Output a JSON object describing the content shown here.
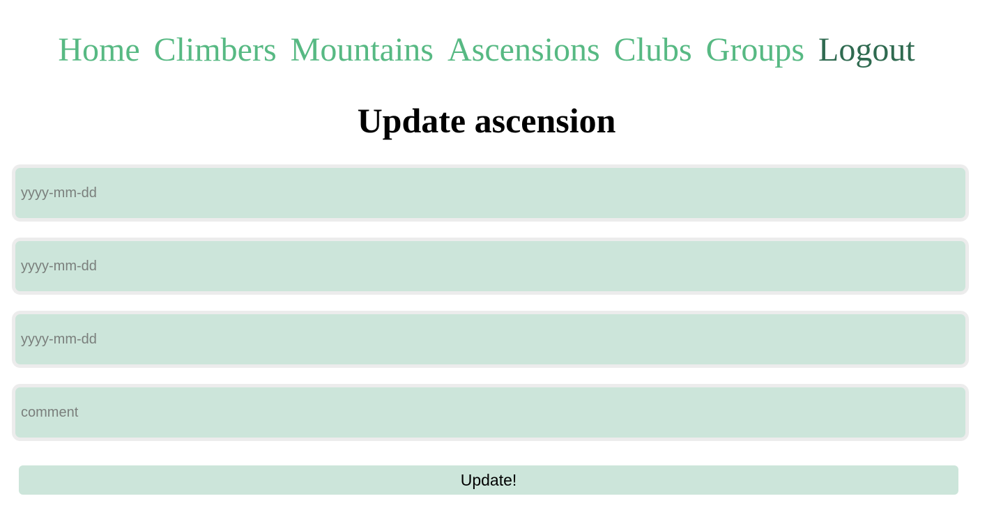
{
  "nav": {
    "items": [
      {
        "label": "Home"
      },
      {
        "label": "Climbers"
      },
      {
        "label": "Mountains"
      },
      {
        "label": "Ascensions"
      },
      {
        "label": "Clubs"
      },
      {
        "label": "Groups"
      },
      {
        "label": "Logout"
      }
    ]
  },
  "page": {
    "title": "Update ascension"
  },
  "form": {
    "fields": [
      {
        "value": "",
        "placeholder": "yyyy-mm-dd"
      },
      {
        "value": "",
        "placeholder": "yyyy-mm-dd"
      },
      {
        "value": "",
        "placeholder": "yyyy-mm-dd"
      },
      {
        "value": "",
        "placeholder": "comment"
      }
    ],
    "submit_label": "Update!"
  },
  "colors": {
    "nav_link": "#57b983",
    "nav_link_active": "#2f6a50",
    "input_background": "#cce5da",
    "input_border": "#ececec",
    "button_background": "#cce5da"
  }
}
